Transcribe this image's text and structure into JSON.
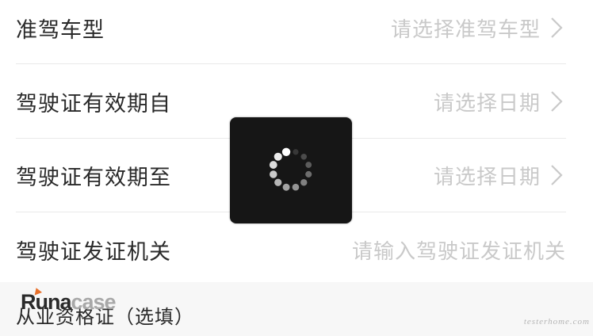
{
  "form": {
    "rows": [
      {
        "label": "准驾车型",
        "value": "请选择准驾车型",
        "has_chevron": true
      },
      {
        "label": "驾驶证有效期自",
        "value": "请选择日期",
        "has_chevron": true
      },
      {
        "label": "驾驶证有效期至",
        "value": "请选择日期",
        "has_chevron": true
      },
      {
        "label": "驾驶证发证机关",
        "value": "请输入驾驶证发证机关",
        "has_chevron": false
      }
    ],
    "optional_section": {
      "label": "从业资格证（选填）"
    }
  },
  "overlay": {
    "logo_text_main": "Runa",
    "logo_text_secondary": "case",
    "watermark": "testerhome.com"
  },
  "loading": {
    "icon": "spinner-icon",
    "colors": {
      "background": "#161616",
      "dots": "#ffffff"
    }
  }
}
